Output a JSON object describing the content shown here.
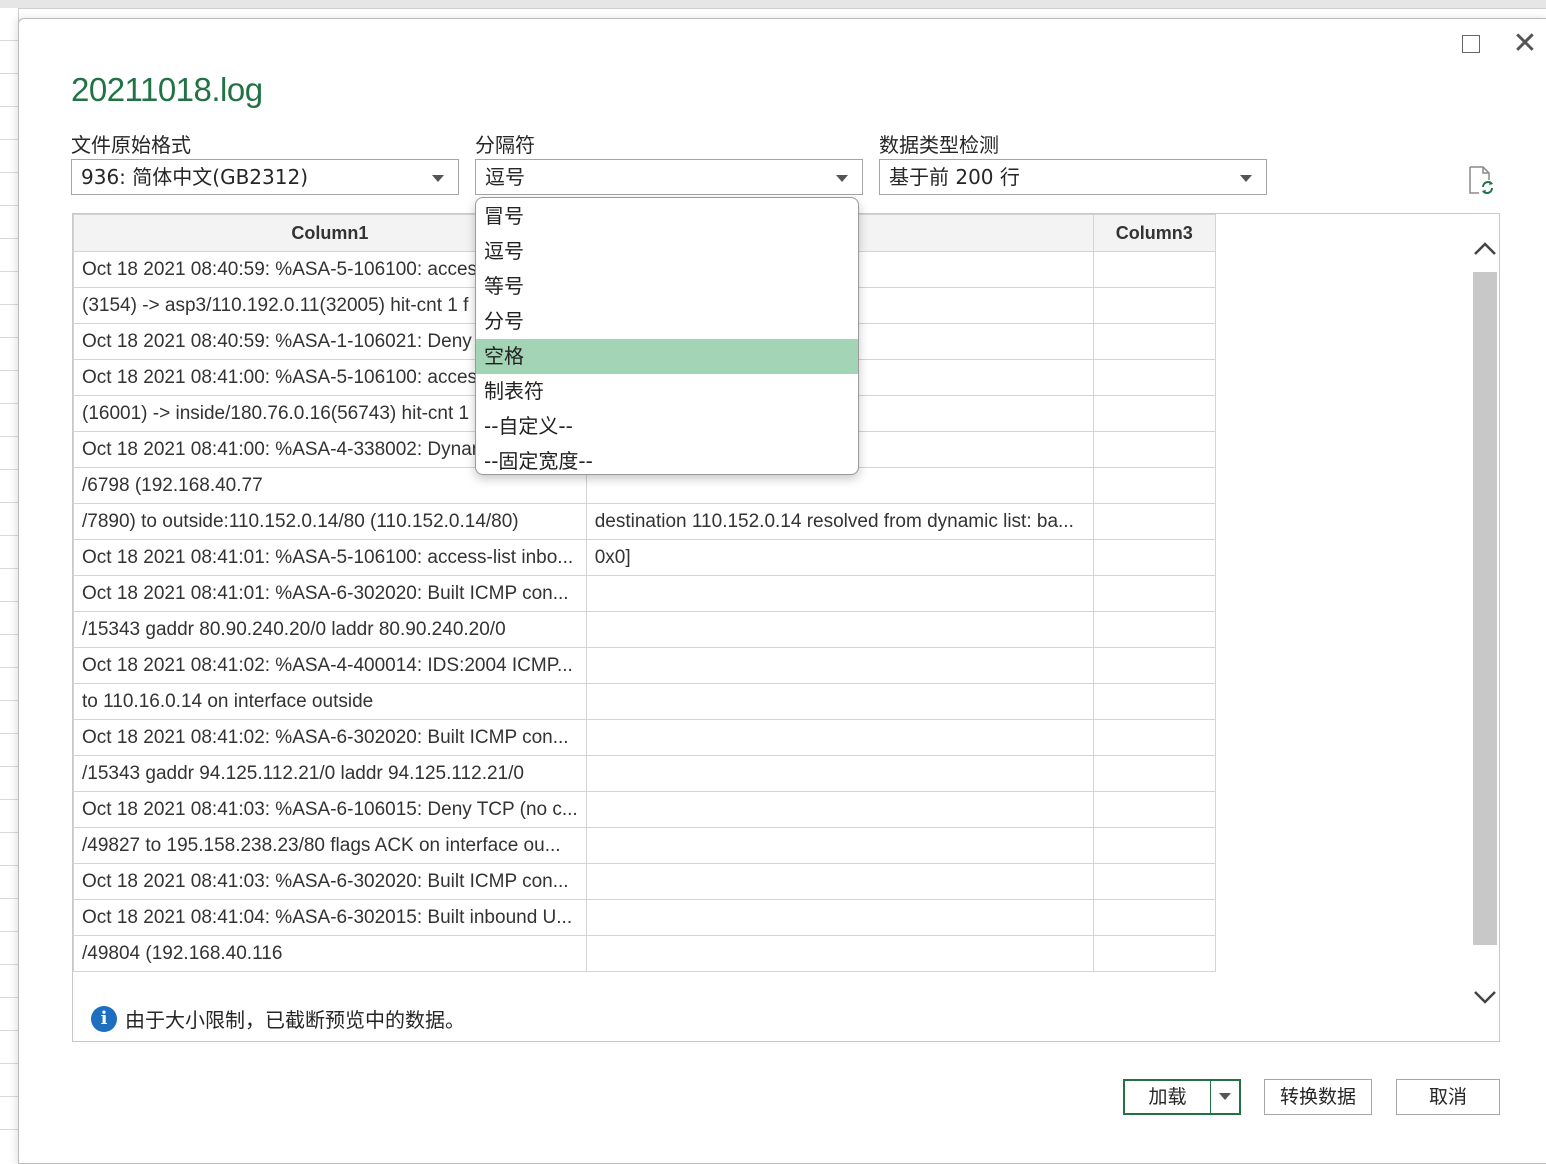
{
  "dialog": {
    "title": "20211018.log"
  },
  "fields": {
    "file_origin_label": "文件原始格式",
    "file_origin_value": "936: 简体中文(GB2312)",
    "delimiter_label": "分隔符",
    "delimiter_value": "逗号",
    "type_detection_label": "数据类型检测",
    "type_detection_value": "基于前 200 行"
  },
  "dropdown": {
    "options": [
      "冒号",
      "逗号",
      "等号",
      "分号",
      "空格",
      "制表符",
      "--自定义--",
      "--固定宽度--"
    ],
    "highlighted": "空格"
  },
  "table": {
    "headers": [
      "Column1",
      "",
      "Column3"
    ],
    "rows": [
      [
        "Oct 18 2021 08:40:59: %ASA-5-106100: access",
        "",
        ""
      ],
      [
        "(3154) -> asp3/110.192.0.11(32005) hit-cnt 1 f",
        "",
        ""
      ],
      [
        "Oct 18 2021 08:40:59: %ASA-1-106021: Deny i",
        "",
        ""
      ],
      [
        "Oct 18 2021 08:41:00: %ASA-5-106100: access",
        "",
        ""
      ],
      [
        "(16001) -> inside/180.76.0.16(56743) hit-cnt 1",
        "",
        ""
      ],
      [
        "Oct 18 2021 08:41:00: %ASA-4-338002: Dynam",
        "",
        ""
      ],
      [
        "/6798 (192.168.40.77",
        "",
        ""
      ],
      [
        "/7890) to outside:110.152.0.14/80 (110.152.0.14/80)",
        "destination 110.152.0.14 resolved from dynamic list: ba...",
        ""
      ],
      [
        "Oct 18 2021 08:41:01: %ASA-5-106100: access-list inbo...",
        "0x0]",
        ""
      ],
      [
        "Oct 18 2021 08:41:01: %ASA-6-302020: Built ICMP con...",
        "",
        ""
      ],
      [
        "/15343 gaddr 80.90.240.20/0 laddr 80.90.240.20/0",
        "",
        ""
      ],
      [
        "Oct 18 2021 08:41:02: %ASA-4-400014: IDS:2004 ICMP...",
        "",
        ""
      ],
      [
        "to 110.16.0.14 on interface outside",
        "",
        ""
      ],
      [
        "Oct 18 2021 08:41:02: %ASA-6-302020: Built ICMP con...",
        "",
        ""
      ],
      [
        "/15343 gaddr 94.125.112.21/0 laddr 94.125.112.21/0",
        "",
        ""
      ],
      [
        "Oct 18 2021 08:41:03: %ASA-6-106015: Deny TCP (no c...",
        "",
        ""
      ],
      [
        "/49827 to 195.158.238.23/80 flags ACK on interface ou...",
        "",
        ""
      ],
      [
        "Oct 18 2021 08:41:03: %ASA-6-302020: Built ICMP con...",
        "",
        ""
      ],
      [
        "Oct 18 2021 08:41:04: %ASA-6-302015: Built inbound U...",
        "",
        ""
      ],
      [
        "/49804 (192.168.40.116",
        "",
        ""
      ]
    ]
  },
  "notice": {
    "text": "由于大小限制，已截断预览中的数据。",
    "icon": "info-icon"
  },
  "buttons": {
    "load": "加载",
    "transform": "转换数据",
    "cancel": "取消"
  },
  "colors": {
    "title_green": "#217346",
    "highlight": "#a3d4b5"
  }
}
